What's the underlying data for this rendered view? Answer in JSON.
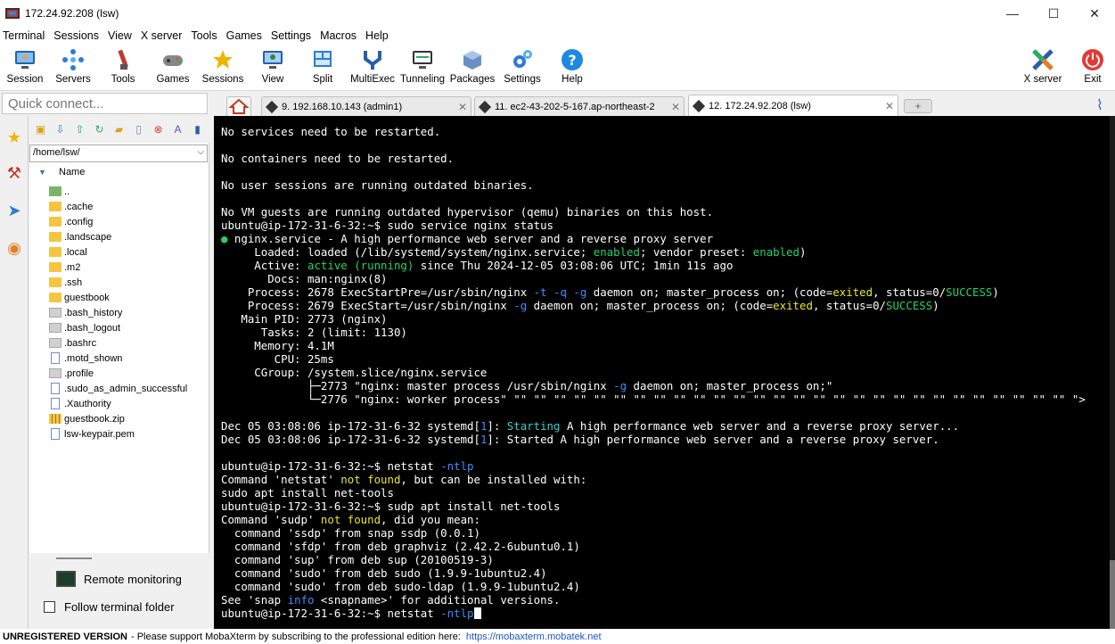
{
  "window": {
    "title": "172.24.92.208 (lsw)",
    "minimize": "—",
    "maximize": "☐",
    "close": "✕"
  },
  "menu": [
    "Terminal",
    "Sessions",
    "View",
    "X server",
    "Tools",
    "Games",
    "Settings",
    "Macros",
    "Help"
  ],
  "toolbar": {
    "buttons": [
      {
        "label": "Session",
        "icon": "session-icon"
      },
      {
        "label": "Servers",
        "icon": "servers-icon"
      },
      {
        "label": "Tools",
        "icon": "tools-icon"
      },
      {
        "label": "Games",
        "icon": "games-icon"
      },
      {
        "label": "Sessions",
        "icon": "sessions-star-icon"
      },
      {
        "label": "View",
        "icon": "view-icon"
      },
      {
        "label": "Split",
        "icon": "split-icon"
      },
      {
        "label": "MultiExec",
        "icon": "multiexec-icon"
      },
      {
        "label": "Tunneling",
        "icon": "tunneling-icon"
      },
      {
        "label": "Packages",
        "icon": "packages-icon"
      },
      {
        "label": "Settings",
        "icon": "settings-gear-icon"
      },
      {
        "label": "Help",
        "icon": "help-icon"
      }
    ],
    "xserver": "X server",
    "exit": "Exit"
  },
  "quick_connect": {
    "placeholder": "Quick connect..."
  },
  "tabs": [
    {
      "label": "9. 192.168.10.143 (admin1)",
      "active": false
    },
    {
      "label": "11. ec2-43-202-5-167.ap-northeast-2",
      "active": false
    },
    {
      "label": "12. 172.24.92.208 (lsw)",
      "active": true
    }
  ],
  "sftp": {
    "path": "/home/lsw/",
    "column_name": "Name",
    "files": [
      {
        "name": "..",
        "type": "up"
      },
      {
        "name": ".cache",
        "type": "folder"
      },
      {
        "name": ".config",
        "type": "folder"
      },
      {
        "name": ".landscape",
        "type": "folder"
      },
      {
        "name": ".local",
        "type": "folder"
      },
      {
        "name": ".m2",
        "type": "folder"
      },
      {
        "name": ".ssh",
        "type": "folder"
      },
      {
        "name": "guestbook",
        "type": "folder"
      },
      {
        "name": ".bash_history",
        "type": "hidden"
      },
      {
        "name": ".bash_logout",
        "type": "hidden"
      },
      {
        "name": ".bashrc",
        "type": "hidden"
      },
      {
        "name": ".motd_shown",
        "type": "doc"
      },
      {
        "name": ".profile",
        "type": "hidden"
      },
      {
        "name": ".sudo_as_admin_successful",
        "type": "doc"
      },
      {
        "name": ".Xauthority",
        "type": "doc"
      },
      {
        "name": "guestbook.zip",
        "type": "zip"
      },
      {
        "name": "lsw-keypair.pem",
        "type": "doc"
      }
    ],
    "remote_monitoring": "Remote monitoring",
    "follow_terminal": "Follow terminal folder"
  },
  "terminal": {
    "lines": [
      [
        {
          "t": "No services need to be restarted."
        }
      ],
      [],
      [
        {
          "t": "No containers need to be restarted."
        }
      ],
      [],
      [
        {
          "t": "No user sessions are running outdated binaries."
        }
      ],
      [],
      [
        {
          "t": "No VM guests are running outdated hypervisor (qemu) binaries on this host."
        }
      ],
      [
        {
          "t": "ubuntu@ip-172-31-6-32:~$ sudo service nginx status"
        }
      ],
      [
        {
          "t": "● ",
          "c": "g"
        },
        {
          "t": "nginx.service - A high performance web server and a reverse proxy server"
        }
      ],
      [
        {
          "t": "     Loaded: loaded (/lib/systemd/system/nginx.service; "
        },
        {
          "t": "enabled",
          "c": "g"
        },
        {
          "t": "; vendor preset: "
        },
        {
          "t": "enabled",
          "c": "g"
        },
        {
          "t": ")"
        }
      ],
      [
        {
          "t": "     Active: "
        },
        {
          "t": "active (running)",
          "c": "g"
        },
        {
          "t": " since Thu 2024-12-05 03:08:06 UTC; 1min 11s ago"
        }
      ],
      [
        {
          "t": "       Docs: man:nginx(8)"
        }
      ],
      [
        {
          "t": "    Process: 2678 ExecStartPre=/usr/sbin/nginx "
        },
        {
          "t": "-t -q -g",
          "c": "b"
        },
        {
          "t": " daemon on; master_process on; (code="
        },
        {
          "t": "exited",
          "c": "y"
        },
        {
          "t": ", status=0/"
        },
        {
          "t": "SUCCESS",
          "c": "g"
        },
        {
          "t": ")"
        }
      ],
      [
        {
          "t": "    Process: 2679 ExecStart=/usr/sbin/nginx "
        },
        {
          "t": "-g",
          "c": "b"
        },
        {
          "t": " daemon on; master_process on; (code="
        },
        {
          "t": "exited",
          "c": "y"
        },
        {
          "t": ", status=0/"
        },
        {
          "t": "SUCCESS",
          "c": "g"
        },
        {
          "t": ")"
        }
      ],
      [
        {
          "t": "   Main PID: 2773 (nginx)"
        }
      ],
      [
        {
          "t": "      Tasks: 2 (limit: 1130)"
        }
      ],
      [
        {
          "t": "     Memory: 4.1M"
        }
      ],
      [
        {
          "t": "        CPU: 25ms"
        }
      ],
      [
        {
          "t": "     CGroup: /system.slice/nginx.service"
        }
      ],
      [
        {
          "t": "             ├─2773 \"nginx: master process /usr/sbin/nginx "
        },
        {
          "t": "-g",
          "c": "b"
        },
        {
          "t": " daemon on; master_process on;\""
        }
      ],
      [
        {
          "t": "             └─2776 \"nginx: worker process\" \"\" \"\" \"\" \"\" \"\" \"\" \"\" \"\" \"\" \"\" \"\" \"\" \"\" \"\" \"\" \"\" \"\" \"\" \"\" \"\" \"\" \"\" \"\" \"\" \"\" \"\" \"\" \"\" \">"
        }
      ],
      [],
      [
        {
          "t": "Dec 05 03:08:06 ip-172-31-6-32 systemd["
        },
        {
          "t": "1",
          "c": "b"
        },
        {
          "t": "]: "
        },
        {
          "t": "Starting",
          "c": "c"
        },
        {
          "t": " A high performance web server and a reverse proxy server..."
        }
      ],
      [
        {
          "t": "Dec 05 03:08:06 ip-172-31-6-32 systemd["
        },
        {
          "t": "1",
          "c": "b"
        },
        {
          "t": "]: Started A high performance web server and a reverse proxy server."
        }
      ],
      [],
      [
        {
          "t": "ubuntu@ip-172-31-6-32:~$ netstat "
        },
        {
          "t": "-ntlp",
          "c": "b"
        }
      ],
      [
        {
          "t": "Command 'netstat' "
        },
        {
          "t": "not found",
          "c": "y"
        },
        {
          "t": ", but can be installed with:"
        }
      ],
      [
        {
          "t": "sudo apt install net-tools"
        }
      ],
      [
        {
          "t": "ubuntu@ip-172-31-6-32:~$ sudp apt install net-tools"
        }
      ],
      [
        {
          "t": "Command 'sudp' "
        },
        {
          "t": "not found",
          "c": "y"
        },
        {
          "t": ", did you mean:"
        }
      ],
      [
        {
          "t": "  command 'ssdp' from snap ssdp (0.0.1)"
        }
      ],
      [
        {
          "t": "  command 'sfdp' from deb graphviz (2.42.2-6ubuntu0.1)"
        }
      ],
      [
        {
          "t": "  command 'sup' from deb sup (20100519-3)"
        }
      ],
      [
        {
          "t": "  command 'sudo' from deb sudo (1.9.9-1ubuntu2.4)"
        }
      ],
      [
        {
          "t": "  command 'sudo' from deb sudo-ldap (1.9.9-1ubuntu2.4)"
        }
      ],
      [
        {
          "t": "See 'snap "
        },
        {
          "t": "info",
          "c": "b"
        },
        {
          "t": " <snapname>' for additional versions."
        }
      ],
      [
        {
          "t": "ubuntu@ip-172-31-6-32:~$ netstat "
        },
        {
          "t": "-ntlp",
          "c": "b"
        },
        {
          "t": "",
          "cursor": true
        }
      ]
    ]
  },
  "status": {
    "unregistered": "UNREGISTERED VERSION",
    "message": "-  Please support MobaXterm by subscribing to the professional edition here:",
    "link": "https://mobaxterm.mobatek.net"
  },
  "colors": {
    "terminal_bg": "#000000",
    "green": "#22d36b",
    "yellow": "#e8e82a",
    "blue": "#3d8cff",
    "cyan": "#3ad0d0"
  }
}
